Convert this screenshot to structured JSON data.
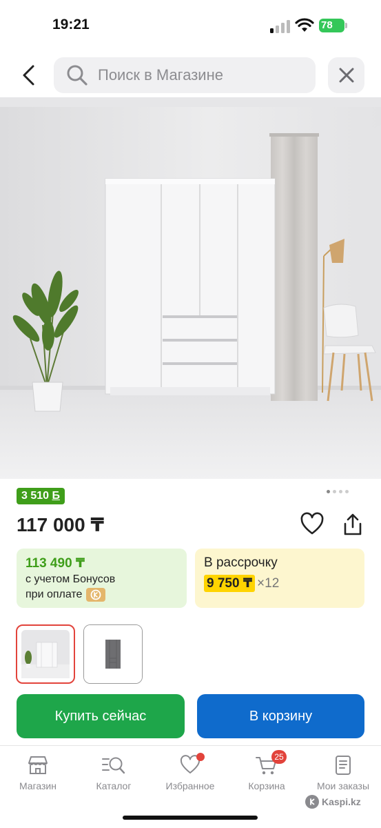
{
  "status_bar": {
    "time": "19:21",
    "battery": "78"
  },
  "search": {
    "placeholder": "Поиск в Магазине"
  },
  "product": {
    "bonus_badge": "3 510 ",
    "bonus_badge_symbol": "Б",
    "price": "117 000 ₸",
    "image_count": 4,
    "active_image": 1
  },
  "bonus_card": {
    "price": "113 490 ₸",
    "line1": "с учетом Бонусов",
    "line2": "при оплате"
  },
  "installment_card": {
    "title": "В рассрочку",
    "amount": "9 750 ₸",
    "multiplier": "×12"
  },
  "actions": {
    "buy_label": "Купить сейчас",
    "cart_label": "В корзину"
  },
  "tab_bar": {
    "items": [
      {
        "label": "Магазин",
        "icon": "store-icon"
      },
      {
        "label": "Каталог",
        "icon": "catalog-icon"
      },
      {
        "label": "Избранное",
        "icon": "heart-icon"
      },
      {
        "label": "Корзина",
        "icon": "cart-icon",
        "badge": "25"
      },
      {
        "label": "Мои заказы",
        "icon": "orders-icon"
      }
    ]
  },
  "watermark": "Kaspi.kz",
  "colors": {
    "green": "#1ea64a",
    "blue": "#0f6bcc",
    "bonus_green": "#3f9e1a",
    "installment_yellow": "#ffd400",
    "accent_red": "#e2433b"
  }
}
